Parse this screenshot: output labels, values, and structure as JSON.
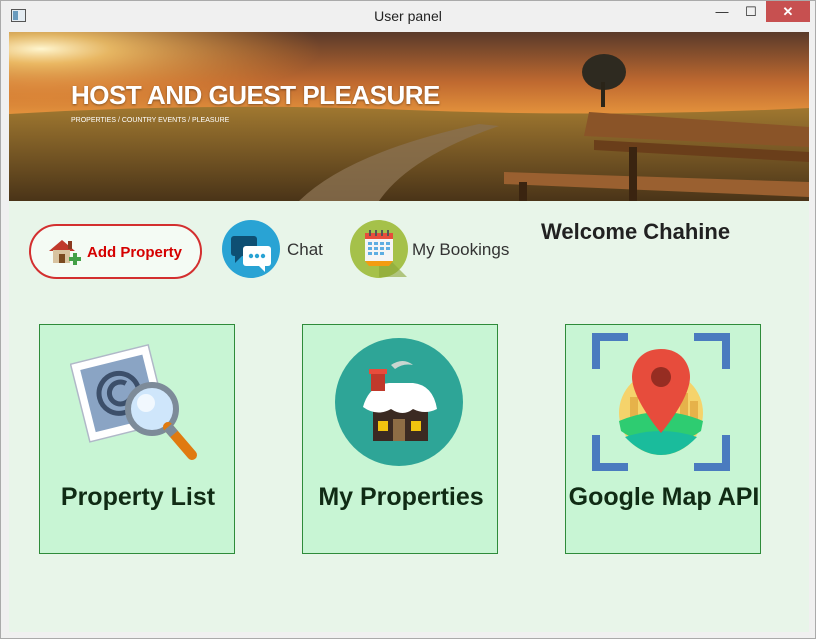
{
  "window": {
    "title": "User panel",
    "minimize_label": "—",
    "maximize_label": "☐",
    "close_label": "✕"
  },
  "banner": {
    "title": "HOST AND GUEST PLEASURE",
    "subtitle": "PROPERTIES / COUNTRY EVENTS / PLEASURE"
  },
  "actions": {
    "add_property": "Add Property",
    "chat": "Chat",
    "my_bookings": "My Bookings"
  },
  "welcome": "Welcome Chahine",
  "cards": {
    "property_list": "Property List",
    "my_properties": "My Properties",
    "google_map": "Google Map API"
  },
  "colors": {
    "background": "#e8f5e9",
    "card_fill": "#c8f5d4",
    "card_border": "#2e8b3a",
    "add_border": "#d32f2f",
    "add_text": "#d50000",
    "close_button": "#c75050"
  },
  "icons": [
    "house-add-icon",
    "chat-icon",
    "calendar-icon",
    "copyright-search-icon",
    "house-snow-icon",
    "map-pin-icon"
  ]
}
